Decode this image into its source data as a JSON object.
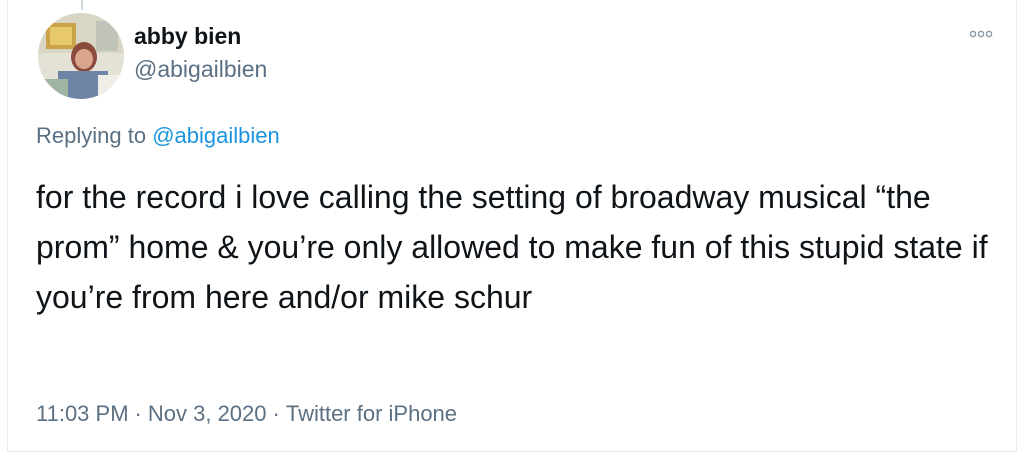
{
  "author": {
    "name": "abby bien",
    "handle": "@abigailbien"
  },
  "reply": {
    "prefix": "Replying to",
    "mention": "@abigailbien"
  },
  "tweet": {
    "text": "for the record i love calling the setting of broadway musical “the prom” home & you’re only allowed to make fun of this stupid state if you’re from here and/or mike schur"
  },
  "meta": {
    "time": "11:03 PM",
    "date": "Nov 3, 2020",
    "source": "Twitter for iPhone",
    "separator": "·"
  },
  "icons": {
    "more": "more-options-icon",
    "avatar": "avatar"
  },
  "colors": {
    "text": "#0f1419",
    "secondary": "#5b7083",
    "link": "#1b95e0",
    "border": "#e6ecf0"
  }
}
